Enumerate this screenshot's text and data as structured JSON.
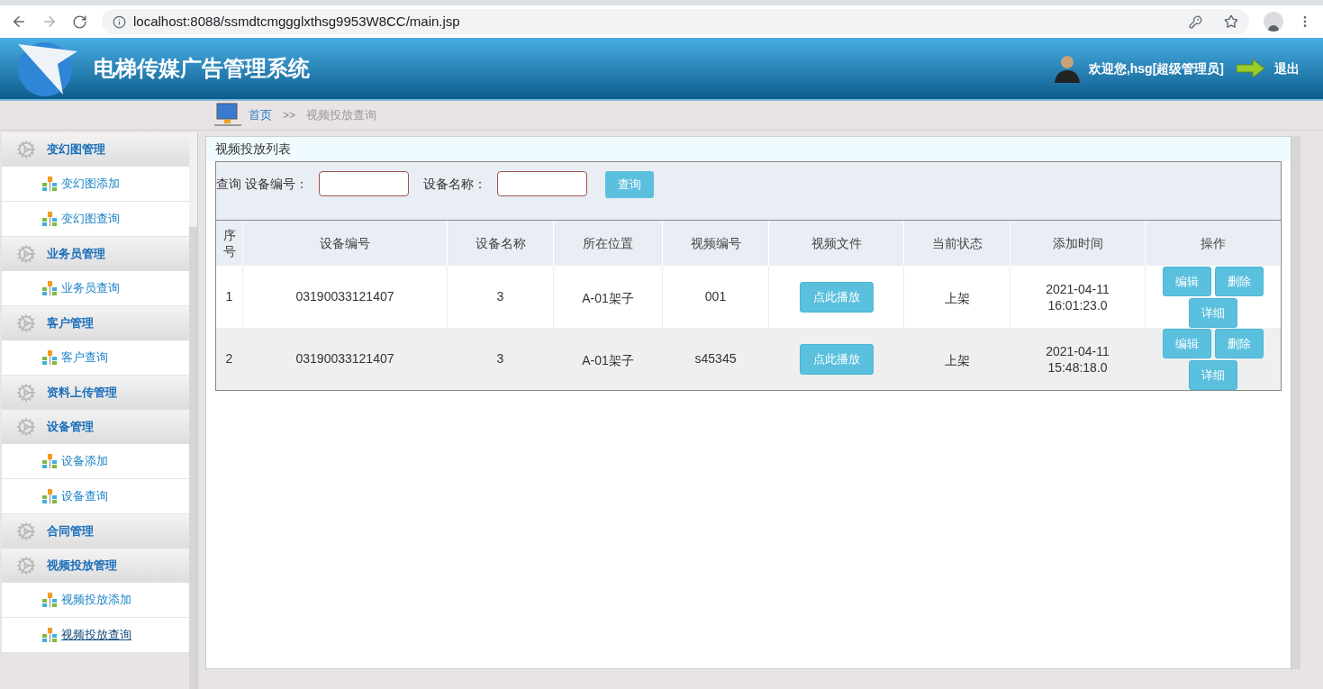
{
  "browser": {
    "url": "localhost:8088/ssmdtcmggglxthsg9953W8CC/main.jsp"
  },
  "header": {
    "title": "电梯传媒广告管理系统",
    "welcome": "欢迎您,hsg[超级管理员]",
    "logout": "退出"
  },
  "breadcrumb": {
    "home": "首页",
    "separator": ">>",
    "current": "视频投放查询"
  },
  "sidebar": {
    "groups": [
      {
        "label": "变幻图管理",
        "children": [
          {
            "label": "变幻图添加",
            "selected": false
          },
          {
            "label": "变幻图查询",
            "selected": false
          }
        ]
      },
      {
        "label": "业务员管理",
        "children": [
          {
            "label": "业务员查询",
            "selected": false
          }
        ]
      },
      {
        "label": "客户管理",
        "children": [
          {
            "label": "客户查询",
            "selected": false
          }
        ]
      },
      {
        "label": "资料上传管理"
      },
      {
        "label": "设备管理",
        "children": [
          {
            "label": "设备添加",
            "selected": false
          },
          {
            "label": "设备查询",
            "selected": false
          }
        ]
      },
      {
        "label": "合同管理"
      },
      {
        "label": "视频投放管理",
        "children": [
          {
            "label": "视频投放添加",
            "selected": false
          },
          {
            "label": "视频投放查询",
            "selected": true
          }
        ]
      }
    ]
  },
  "panel": {
    "title": "视频投放列表",
    "search": {
      "label": "查询",
      "fields": [
        {
          "label": "设备编号："
        },
        {
          "label": "设备名称："
        }
      ],
      "button": "查询"
    },
    "table": {
      "columns": [
        "序号",
        "设备编号",
        "设备名称",
        "所在位置",
        "视频编号",
        "视频文件",
        "当前状态",
        "添加时间",
        "操作"
      ],
      "rows": [
        {
          "cells": [
            "1",
            "03190033121407",
            "3",
            "A-01架子",
            "001"
          ],
          "play": "点此播放",
          "status": "上架",
          "date": "2021-04-11",
          "time": "16:01:23.0",
          "actions": [
            "编辑",
            "删除",
            "详细"
          ]
        },
        {
          "cells": [
            "2",
            "03190033121407",
            "3",
            "A-01架子",
            "s45345"
          ],
          "play": "点此播放",
          "status": "上架",
          "date": "2021-04-11",
          "time": "15:48:18.0",
          "actions": [
            "编辑",
            "删除",
            "详细"
          ]
        }
      ]
    }
  }
}
